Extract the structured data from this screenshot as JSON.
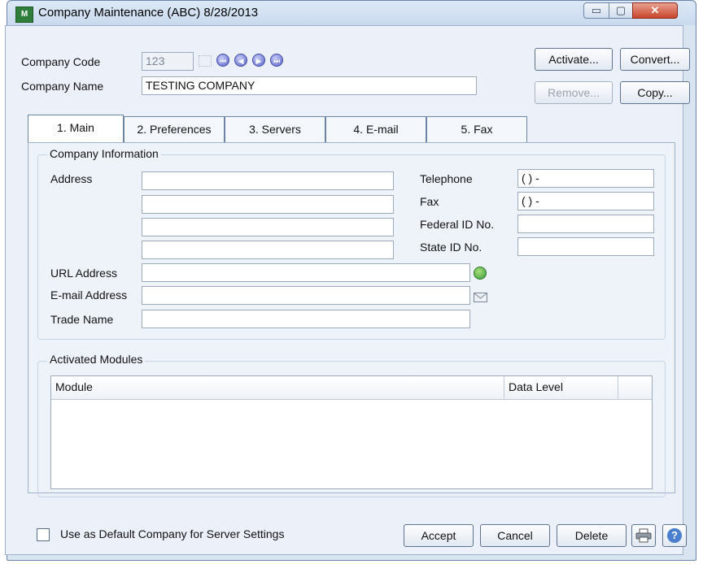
{
  "window": {
    "title": "Company Maintenance (ABC) 8/28/2013",
    "app_icon_text": "M",
    "min_glyph": "▭",
    "max_glyph": "▢",
    "close_glyph": "✕"
  },
  "header": {
    "company_code_label": "Company Code",
    "company_code_value": "123",
    "company_name_label": "Company Name",
    "company_name_value": "TESTING COMPANY",
    "nav": [
      "⏮",
      "◀",
      "▶",
      "⏭"
    ]
  },
  "actions": {
    "activate": "Activate...",
    "convert": "Convert...",
    "remove": "Remove...",
    "copy": "Copy..."
  },
  "tabs": [
    "1. Main",
    "2. Preferences",
    "3. Servers",
    "4. E-mail",
    "5. Fax"
  ],
  "company_info": {
    "title": "Company Information",
    "address_label": "Address",
    "url_label": "URL Address",
    "email_label": "E-mail Address",
    "trade_name_label": "Trade Name",
    "telephone_label": "Telephone",
    "telephone_value": "(  )    -",
    "fax_label": "Fax",
    "fax_value": "(  )    -",
    "federal_id_label": "Federal ID No.",
    "state_id_label": "State ID No.",
    "url_icon": "globe-icon",
    "email_icon": "envelope-icon"
  },
  "modules": {
    "title": "Activated Modules",
    "columns": [
      "Module",
      "Data Level"
    ]
  },
  "footer": {
    "default_company_label": "Use as Default Company for Server Settings",
    "accept": "Accept",
    "cancel": "Cancel",
    "delete": "Delete",
    "print_icon": "printer-icon",
    "help_glyph": "?"
  },
  "colors": {
    "accent": "#5a64c9",
    "window_bg": "#d9e4f1",
    "panel_bg": "#eef3fa"
  }
}
